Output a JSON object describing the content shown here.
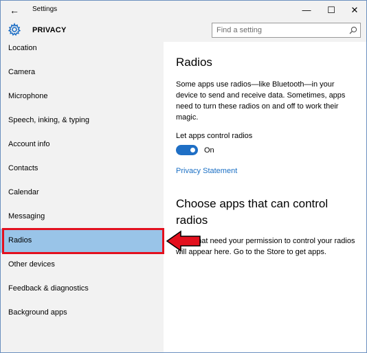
{
  "window": {
    "title": "Settings",
    "back_icon": "back-arrow-icon",
    "controls": {
      "minimize": "—",
      "maximize": "☐",
      "close": "✕"
    }
  },
  "header": {
    "icon": "gear-icon",
    "title": "PRIVACY",
    "search_placeholder": "Find a setting"
  },
  "sidebar": {
    "items": [
      {
        "label": "Location"
      },
      {
        "label": "Camera"
      },
      {
        "label": "Microphone"
      },
      {
        "label": "Speech, inking, & typing"
      },
      {
        "label": "Account info"
      },
      {
        "label": "Contacts"
      },
      {
        "label": "Calendar"
      },
      {
        "label": "Messaging"
      },
      {
        "label": "Radios",
        "selected": true
      },
      {
        "label": "Other devices"
      },
      {
        "label": "Feedback & diagnostics"
      },
      {
        "label": "Background apps"
      }
    ]
  },
  "main": {
    "heading": "Radios",
    "description": "Some apps use radios—like Bluetooth—in your device to send and receive data. Sometimes, apps need to turn these radios on and off to work their magic.",
    "toggle_label": "Let apps control radios",
    "toggle_state": "On",
    "toggle_on": true,
    "privacy_link": "Privacy Statement",
    "section2_heading": "Choose apps that can control radios",
    "section2_text": "Apps that need your permission to control your radios will appear here. Go to the Store to get apps."
  },
  "colors": {
    "accent": "#1f6fc5",
    "selected_bg": "#99c4e8",
    "annotation_red": "#e3101e",
    "link": "#1a6fc4"
  }
}
